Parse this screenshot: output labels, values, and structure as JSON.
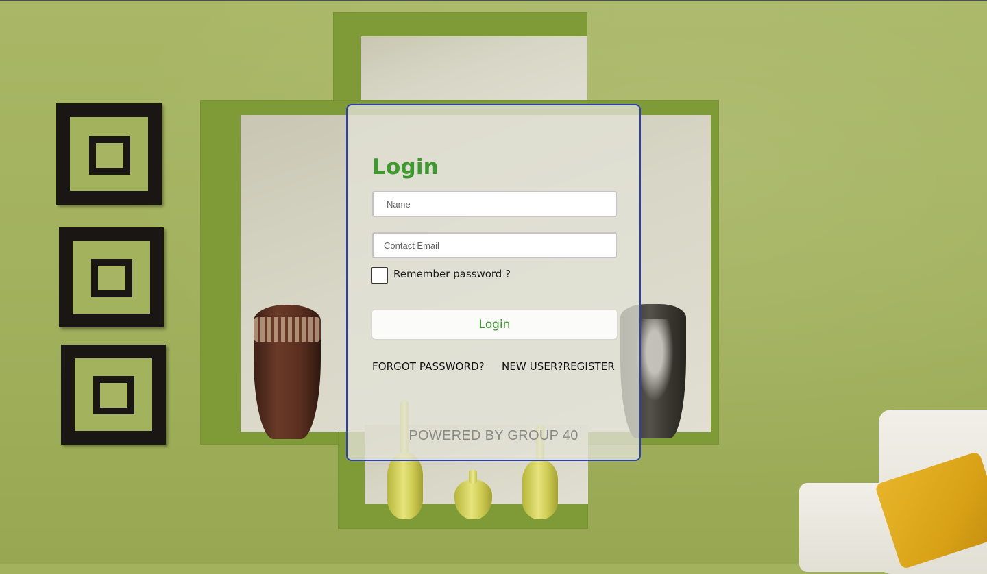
{
  "login": {
    "title": "Login",
    "name_placeholder": "Name",
    "email_placeholder": "Contact Email",
    "remember_label": "Remember password ?",
    "login_button": "Login",
    "forgot_link": "FORGOT PASSWORD?",
    "register_link": "NEW USER?REGISTER",
    "footer": "POWERED BY GROUP 40"
  },
  "colors": {
    "accent_green": "#3e9a2e",
    "card_border": "#2d3fb4",
    "wall_green": "#a3b25c"
  }
}
